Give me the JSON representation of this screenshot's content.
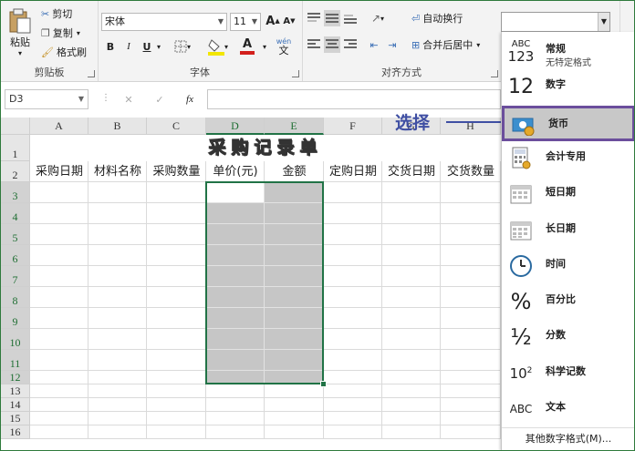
{
  "ribbon": {
    "clipboard": {
      "paste": "粘贴",
      "cut": "剪切",
      "copy": "复制",
      "format_painter": "格式刷",
      "group": "剪贴板"
    },
    "font": {
      "name": "宋体",
      "size": "11",
      "bold": "B",
      "italic": "I",
      "underline": "U",
      "font_color_letter": "A",
      "fill_color": "#f2e600",
      "font_color": "#d2201c",
      "wen": "wén",
      "wen_char": "文",
      "grow": "A",
      "shrink": "A",
      "group": "字体"
    },
    "alignment": {
      "wrap": "自动换行",
      "merge": "合并后居中",
      "group": "对齐方式"
    }
  },
  "formula_bar": {
    "name_box": "D3",
    "cancel": "✕",
    "enter": "✓",
    "fx": "fx"
  },
  "columns": [
    "A",
    "B",
    "C",
    "D",
    "E",
    "F",
    "G",
    "H"
  ],
  "rows": [
    "1",
    "2",
    "3",
    "4",
    "5",
    "6",
    "7",
    "8",
    "9",
    "10",
    "11",
    "12",
    "13",
    "14",
    "15",
    "16"
  ],
  "sheet": {
    "title": "采购记录单",
    "headers": [
      "采购日期",
      "材料名称",
      "采购数量",
      "单价(元)",
      "金额",
      "定购日期",
      "交货日期",
      "交货数量"
    ]
  },
  "number_format": {
    "items": [
      {
        "label": "常规",
        "sub": "无特定格式",
        "icon": "general-icon",
        "icon_text_1": "ABC",
        "icon_text_2": "123"
      },
      {
        "label": "数字",
        "sub": "",
        "icon": "number-icon",
        "icon_text_1": "12"
      },
      {
        "label": "货币",
        "sub": "",
        "icon": "currency-icon"
      },
      {
        "label": "会计专用",
        "sub": "",
        "icon": "accounting-icon"
      },
      {
        "label": "短日期",
        "sub": "",
        "icon": "short-date-icon"
      },
      {
        "label": "长日期",
        "sub": "",
        "icon": "long-date-icon"
      },
      {
        "label": "时间",
        "sub": "",
        "icon": "time-icon"
      },
      {
        "label": "百分比",
        "sub": "",
        "icon": "percent-icon",
        "icon_text_1": "%"
      },
      {
        "label": "分数",
        "sub": "",
        "icon": "fraction-icon",
        "icon_text_1": "½"
      },
      {
        "label": "科学记数",
        "sub": "",
        "icon": "scientific-icon",
        "icon_text_1": "10",
        "icon_text_2": "2"
      },
      {
        "label": "文本",
        "sub": "",
        "icon": "text-icon",
        "icon_text_1": "ABC"
      }
    ],
    "more": "其他数字格式(M)...",
    "highlighted_index": 2
  },
  "annotation": {
    "text": "选择"
  },
  "colors": {
    "accent": "#217346",
    "annotation": "#3f4fa3",
    "highlight_border": "#6b4e9c"
  }
}
